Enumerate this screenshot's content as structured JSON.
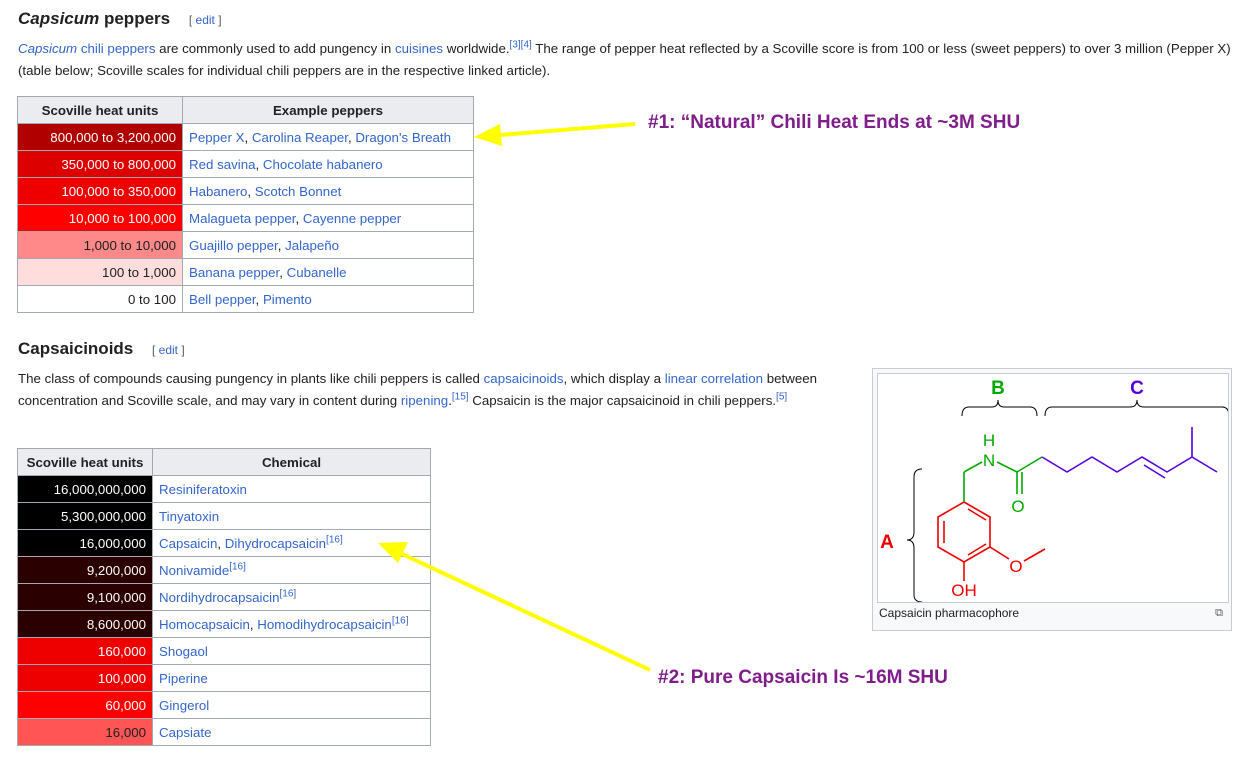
{
  "section1": {
    "heading_italic": "Capsicum",
    "heading_rest": " peppers",
    "edit_label": "edit",
    "para": {
      "t1": "Capsicum",
      "t2": " ",
      "t3": "chili peppers",
      "t4": " are commonly used to add pungency in ",
      "t5": "cuisines",
      "t6": " worldwide.",
      "ref1": "[3]",
      "ref2": "[4]",
      "t7": " The range of pepper heat reflected by a Scoville score is from 100 or less (sweet peppers) to over 3 million (Pepper X) (table below; Scoville scales for individual chili peppers are in the respective linked article)."
    },
    "table": {
      "headers": [
        "Scoville heat units",
        "Example peppers"
      ],
      "rows": [
        {
          "shu": "800,000 to 3,200,000",
          "bg": "#b00000",
          "fg": "#ffffff",
          "peppers": [
            "Pepper X",
            "Carolina Reaper",
            "Dragon's Breath"
          ]
        },
        {
          "shu": "350,000 to 800,000",
          "bg": "#dd0000",
          "fg": "#ffffff",
          "peppers": [
            "Red savina",
            "Chocolate habanero"
          ]
        },
        {
          "shu": "100,000 to 350,000",
          "bg": "#ee0000",
          "fg": "#ffffff",
          "peppers": [
            "Habanero",
            "Scotch Bonnet"
          ]
        },
        {
          "shu": "10,000 to 100,000",
          "bg": "#ff0000",
          "fg": "#ffffff",
          "peppers": [
            "Malagueta pepper",
            "Cayenne pepper"
          ]
        },
        {
          "shu": "1,000 to 10,000",
          "bg": "#ff8888",
          "fg": "#202122",
          "peppers": [
            "Guajillo pepper",
            "Jalapeño"
          ]
        },
        {
          "shu": "100 to 1,000",
          "bg": "#ffdddd",
          "fg": "#202122",
          "peppers": [
            "Banana pepper",
            "Cubanelle"
          ]
        },
        {
          "shu": "0 to 100",
          "bg": "#ffffff",
          "fg": "#202122",
          "peppers": [
            "Bell pepper",
            "Pimento"
          ]
        }
      ]
    }
  },
  "section2": {
    "heading": "Capsaicinoids",
    "edit_label": "edit",
    "para": {
      "t1": "The class of compounds causing pungency in plants like chili peppers is called ",
      "t2": "capsaicinoids",
      "t3": ", which display a ",
      "t4": "linear correlation",
      "t5": " between concentration and Scoville scale, and may vary in content during ",
      "t6": "ripening",
      "t7": ".",
      "ref1": "[15]",
      "t8": " Capsaicin is the major capsaicinoid in chili peppers.",
      "ref2": "[5]"
    },
    "table": {
      "headers": [
        "Scoville heat units",
        "Chemical"
      ],
      "rows": [
        {
          "shu": "16,000,000,000",
          "bg": "#000000",
          "fg": "#ffffff",
          "chems": [
            "Resiniferatoxin"
          ],
          "ref": ""
        },
        {
          "shu": "5,300,000,000",
          "bg": "#000000",
          "fg": "#ffffff",
          "chems": [
            "Tinyatoxin"
          ],
          "ref": ""
        },
        {
          "shu": "16,000,000",
          "bg": "#000000",
          "fg": "#ffffff",
          "chems": [
            "Capsaicin",
            "Dihydrocapsaicin"
          ],
          "ref": "[16]"
        },
        {
          "shu": "9,200,000",
          "bg": "#2a0000",
          "fg": "#ffffff",
          "chems": [
            "Nonivamide"
          ],
          "ref": "[16]"
        },
        {
          "shu": "9,100,000",
          "bg": "#2a0000",
          "fg": "#ffffff",
          "chems": [
            "Nordihydrocapsaicin"
          ],
          "ref": "[16]"
        },
        {
          "shu": "8,600,000",
          "bg": "#2a0000",
          "fg": "#ffffff",
          "chems": [
            "Homocapsaicin",
            "Homodihydrocapsaicin"
          ],
          "ref": "[16]"
        },
        {
          "shu": "160,000",
          "bg": "#ee0000",
          "fg": "#ffffff",
          "chems": [
            "Shogaol"
          ],
          "ref": ""
        },
        {
          "shu": "100,000",
          "bg": "#ee0000",
          "fg": "#ffffff",
          "chems": [
            "Piperine"
          ],
          "ref": ""
        },
        {
          "shu": "60,000",
          "bg": "#ff0000",
          "fg": "#ffffff",
          "chems": [
            "Gingerol"
          ],
          "ref": ""
        },
        {
          "shu": "16,000",
          "bg": "#ff5555",
          "fg": "#202122",
          "chems": [
            "Capsiate"
          ],
          "ref": ""
        }
      ]
    }
  },
  "figure": {
    "caption": "Capsaicin pharmacophore",
    "magnify_icon": "⧉",
    "labels": {
      "a": "A",
      "b": "B",
      "c": "C",
      "nh_h": "H",
      "nh_n": "N",
      "o_carbonyl": "O",
      "o_methoxy": "O",
      "oh": "OH"
    },
    "colors": {
      "a": "#ee0000",
      "b": "#00aa00",
      "c": "#5500dd"
    }
  },
  "annotations": {
    "note1": "#1: “Natural” Chili Heat Ends at ~3M SHU",
    "note2": "#2: Pure Capsaicin Is ~16M SHU",
    "arrow_color": "#ffff00",
    "text_color": "#7f1d8a"
  }
}
